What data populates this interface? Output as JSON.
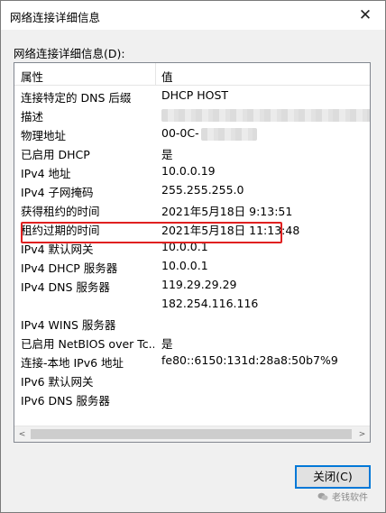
{
  "window": {
    "title": "网络连接详细信息",
    "close_glyph": "✕"
  },
  "group_label": "网络连接详细信息(D):",
  "columns": {
    "property": "属性",
    "value": "值"
  },
  "rows": [
    {
      "name": "连接特定的 DNS 后缀",
      "value": "DHCP HOST"
    },
    {
      "name": "描述",
      "value": ""
    },
    {
      "name": "物理地址",
      "value": "00-0C-"
    },
    {
      "name": "已启用 DHCP",
      "value": "是"
    },
    {
      "name": "IPv4 地址",
      "value": "10.0.0.19"
    },
    {
      "name": "IPv4 子网掩码",
      "value": "255.255.255.0"
    },
    {
      "name": "获得租约的时间",
      "value": "2021年5月18日 9:13:51"
    },
    {
      "name": "租约过期的时间",
      "value": "2021年5月18日 11:13:48"
    },
    {
      "name": "IPv4 默认网关",
      "value": "10.0.0.1"
    },
    {
      "name": "IPv4 DHCP 服务器",
      "value": "10.0.0.1"
    },
    {
      "name": "IPv4 DNS 服务器",
      "value": "119.29.29.29"
    },
    {
      "name": "",
      "value": "182.254.116.116"
    },
    {
      "name": "IPv4 WINS 服务器",
      "value": ""
    },
    {
      "name": "已启用 NetBIOS over Tc...",
      "value": "是"
    },
    {
      "name": "连接-本地 IPv6 地址",
      "value": "fe80::6150:131d:28a8:50b7%9"
    },
    {
      "name": "IPv6 默认网关",
      "value": ""
    },
    {
      "name": "IPv6 DNS 服务器",
      "value": ""
    }
  ],
  "scroll": {
    "left_arrow": "<",
    "right_arrow": ">"
  },
  "buttons": {
    "close_label": "关闭(C)"
  },
  "watermark": {
    "text": "老钱软件"
  },
  "colors": {
    "highlight": "#e02020",
    "focus_border": "#0078d7"
  }
}
